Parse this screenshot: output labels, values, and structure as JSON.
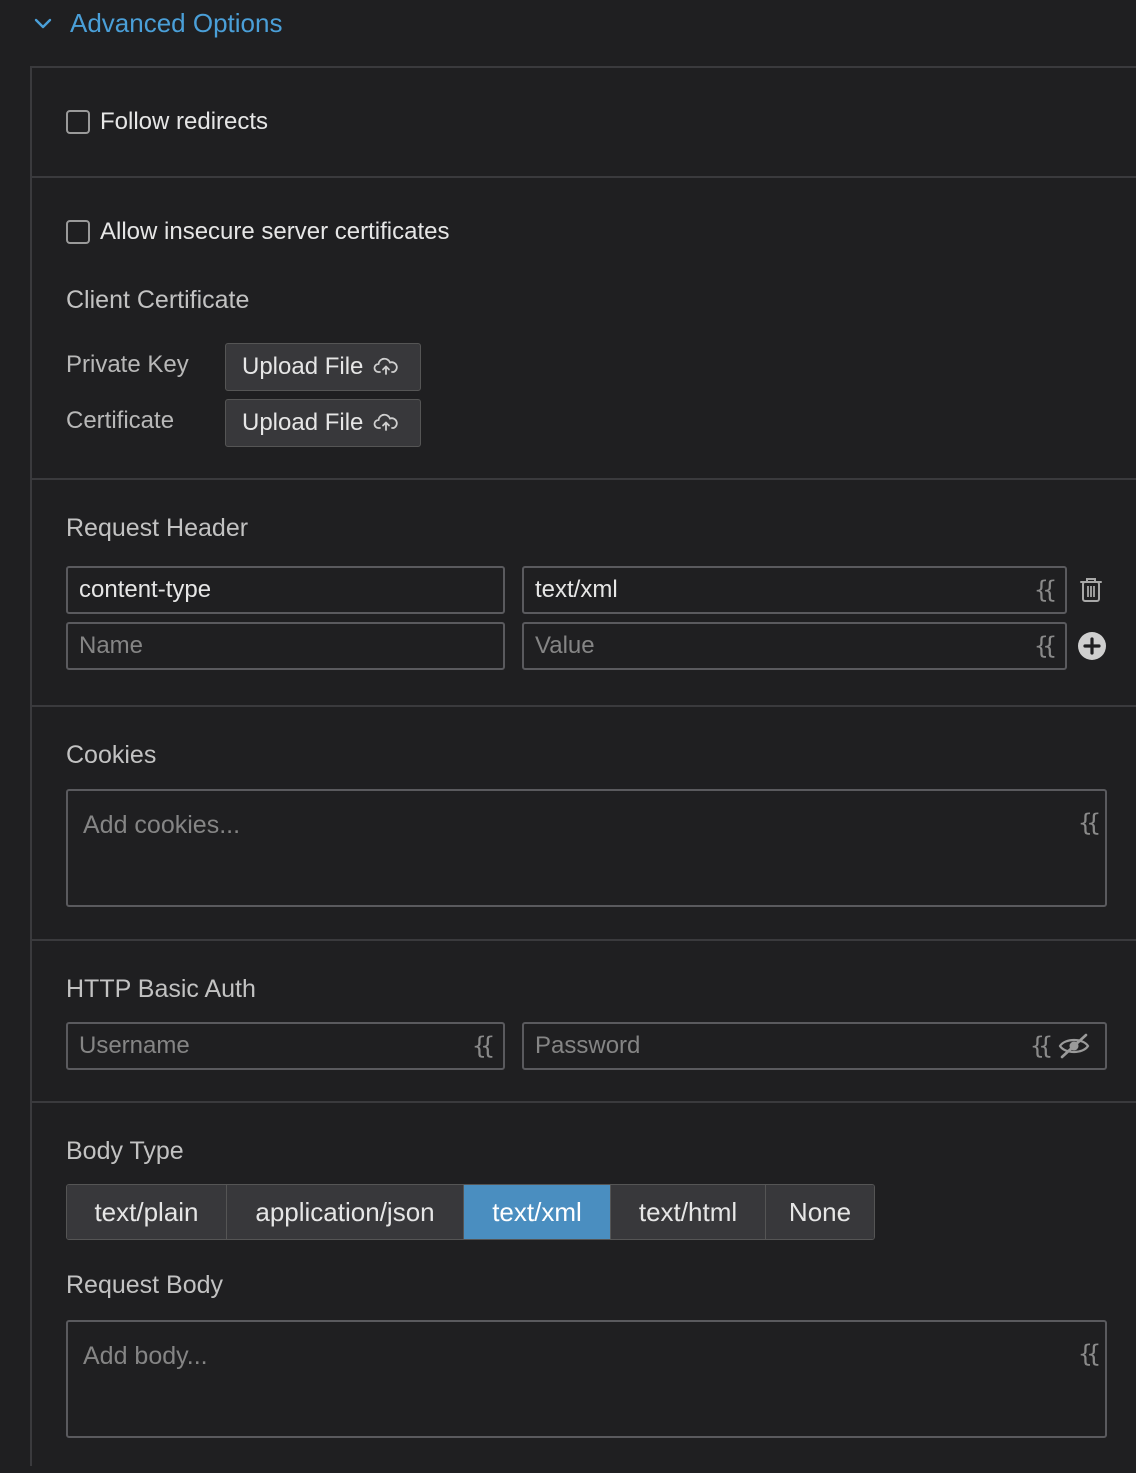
{
  "header": {
    "title": "Advanced Options"
  },
  "follow_redirects": {
    "label": "Follow redirects",
    "checked": false
  },
  "insecure": {
    "label": "Allow insecure server certificates",
    "checked": false
  },
  "client_cert": {
    "title": "Client Certificate",
    "private_key_label": "Private Key",
    "certificate_label": "Certificate",
    "upload_label": "Upload File"
  },
  "request_header": {
    "title": "Request Header",
    "rows": [
      {
        "name": "content-type",
        "value": "text/xml"
      }
    ],
    "name_placeholder": "Name",
    "value_placeholder": "Value",
    "template_glyph": "{{"
  },
  "cookies": {
    "title": "Cookies",
    "placeholder": "Add cookies..."
  },
  "basic_auth": {
    "title": "HTTP Basic Auth",
    "username_placeholder": "Username",
    "password_placeholder": "Password"
  },
  "body_type": {
    "title": "Body Type",
    "options": [
      "text/plain",
      "application/json",
      "text/xml",
      "text/html",
      "None"
    ],
    "selected": "text/xml"
  },
  "request_body": {
    "title": "Request Body",
    "placeholder": "Add body..."
  },
  "colors": {
    "accent": "#4a9fd8",
    "selected": "#4a8ec0",
    "background": "#1f1f21"
  },
  "icons": [
    "chevron-down-icon",
    "cloud-upload-icon",
    "trash-icon",
    "plus-circle-icon",
    "eye-slash-icon",
    "template-icon"
  ]
}
